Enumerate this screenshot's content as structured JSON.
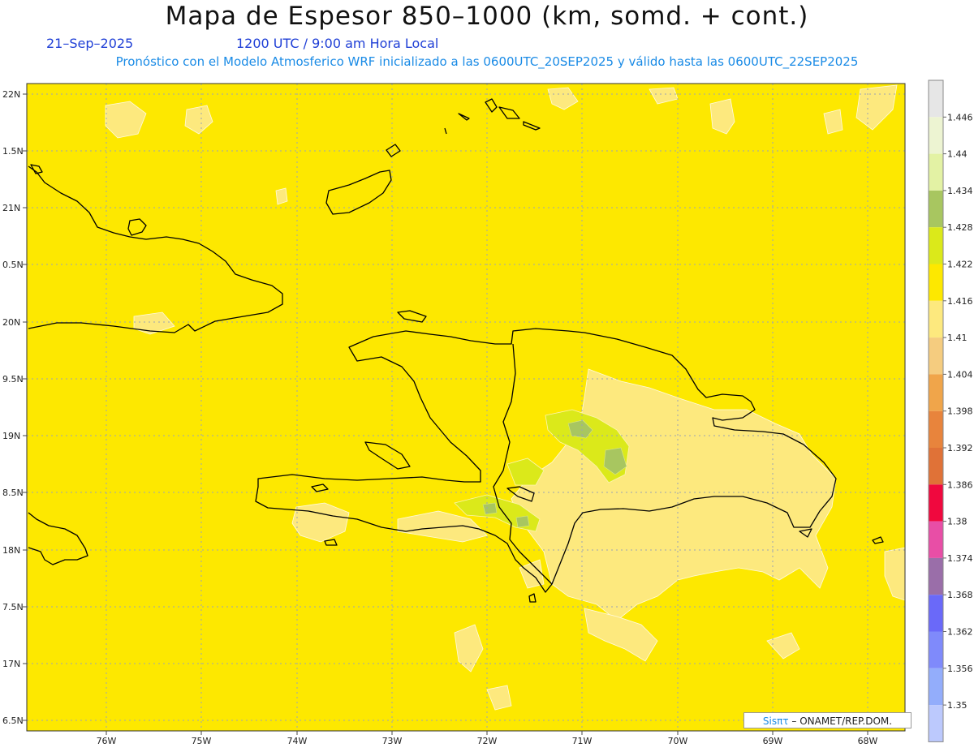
{
  "title": "Mapa de Espesor 850–1000 (km, somd. + cont.)",
  "date": "21–Sep–2025",
  "time": "1200 UTC / 9:00 am Hora Local",
  "info": "Pronóstico con el Modelo Atmosferico WRF inicializado a las 0600UTC_20SEP2025 y válido hasta las  0600UTC_22SEP2025",
  "credit_brand": "Sisπτ",
  "credit_rest": "– ONAMET/REP.DOM.",
  "lat_labels": [
    "22N",
    "1.5N",
    "21N",
    "0.5N",
    "20N",
    "9.5N",
    "19N",
    "8.5N",
    "18N",
    "7.5N",
    "17N",
    "6.5N"
  ],
  "lon_labels": [
    "76W",
    "75W",
    "74W",
    "73W",
    "72W",
    "71W",
    "70W",
    "69W",
    "68W"
  ],
  "colorbar": {
    "labels": [
      "1.446",
      "1.44",
      "1.434",
      "1.428",
      "1.422",
      "1.416",
      "1.41",
      "1.404",
      "1.398",
      "1.392",
      "1.386",
      "1.38",
      "1.374",
      "1.368",
      "1.362",
      "1.356",
      "1.35"
    ],
    "colors": [
      "#e6e6e6",
      "#edf4d2",
      "#e3f2a4",
      "#a8c660",
      "#dbe91a",
      "#fde800",
      "#fde97e",
      "#f5cc7f",
      "#f0a54a",
      "#e8843c",
      "#e07237",
      "#f0083e",
      "#e84ea6",
      "#9a6ea9",
      "#6a69f9",
      "#7f8afb",
      "#93adfb",
      "#bcc9fd"
    ]
  },
  "colors": {
    "field": "#fde800",
    "light_contour": "#fde97e",
    "green_light": "#dbe91a",
    "green_dark": "#a8c660",
    "grid": "#9aa4b4"
  }
}
